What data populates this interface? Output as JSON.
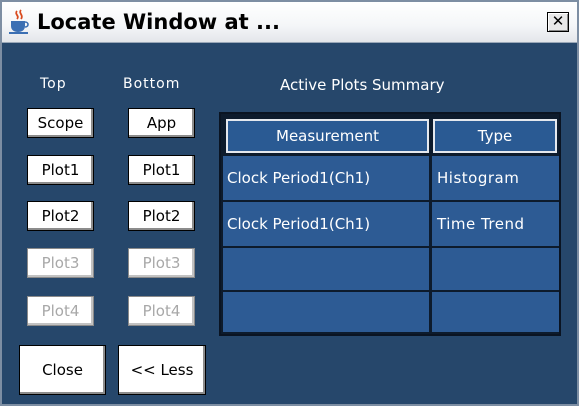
{
  "window": {
    "title": "Locate Window at ...",
    "close_glyph": "✕",
    "icon": "java-cup-icon"
  },
  "columns": {
    "top_label": "Top",
    "bottom_label": "Bottom",
    "summary_label": "Active Plots Summary"
  },
  "top_buttons": [
    {
      "label": "Scope",
      "enabled": true
    },
    {
      "label": "Plot1",
      "enabled": true
    },
    {
      "label": "Plot2",
      "enabled": true
    },
    {
      "label": "Plot3",
      "enabled": false
    },
    {
      "label": "Plot4",
      "enabled": false
    }
  ],
  "bottom_buttons": [
    {
      "label": "App",
      "enabled": true
    },
    {
      "label": "Plot1",
      "enabled": true
    },
    {
      "label": "Plot2",
      "enabled": true
    },
    {
      "label": "Plot3",
      "enabled": false
    },
    {
      "label": "Plot4",
      "enabled": false
    }
  ],
  "actions": {
    "close_label": "Close",
    "less_label": "<< Less"
  },
  "table": {
    "headers": [
      "Measurement",
      "Type"
    ],
    "rows": [
      [
        "Clock Period1(Ch1)",
        "Histogram"
      ],
      [
        "Clock Period1(Ch1)",
        "Time Trend"
      ],
      [
        "",
        ""
      ],
      [
        "",
        ""
      ]
    ]
  },
  "colors": {
    "window_bg": "#26476b",
    "cell_bg": "#2d5b94",
    "header_bg": "#2a5a93",
    "disabled_text": "#a8a8a8"
  }
}
